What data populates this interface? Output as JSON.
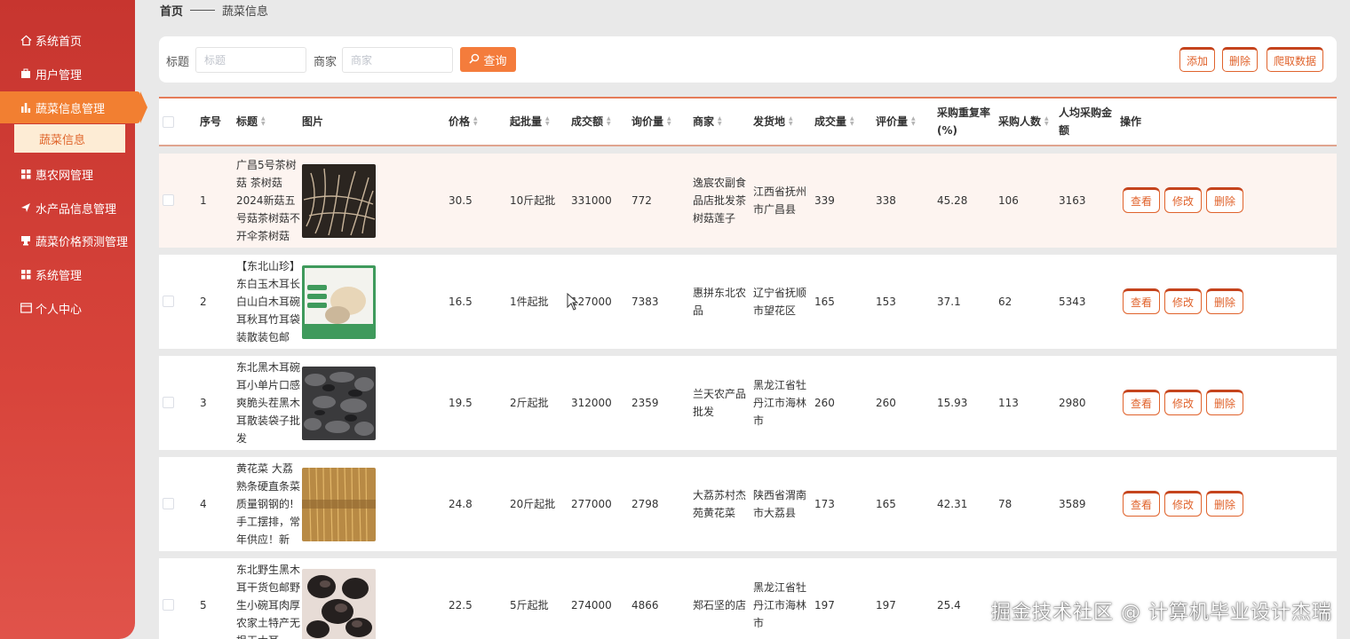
{
  "sidebar": {
    "items": [
      {
        "label": "系统首页",
        "icon": "home-icon"
      },
      {
        "label": "用户管理",
        "icon": "user-icon"
      },
      {
        "label": "蔬菜信息管理",
        "icon": "bar-chart-icon",
        "active": true
      },
      {
        "label": "惠农网管理",
        "icon": "grid-icon"
      },
      {
        "label": "水产品信息管理",
        "icon": "send-icon"
      },
      {
        "label": "蔬菜价格预测管理",
        "icon": "cup-icon"
      },
      {
        "label": "系统管理",
        "icon": "grid-icon"
      },
      {
        "label": "个人中心",
        "icon": "card-icon"
      }
    ],
    "submenu": {
      "label": "蔬菜信息"
    }
  },
  "breadcrumb": {
    "home": "首页",
    "current": "蔬菜信息"
  },
  "search": {
    "title_label": "标题",
    "title_placeholder": "标题",
    "merchant_label": "商家",
    "merchant_placeholder": "商家",
    "query_label": "查询"
  },
  "toolbar": {
    "add": "添加",
    "delete": "删除",
    "crawl": "爬取数据"
  },
  "table": {
    "headers": {
      "index": "序号",
      "title": "标题",
      "image": "图片",
      "price": "价格",
      "min_batch": "起批量",
      "turnover": "成交额",
      "inquiry": "询价量",
      "merchant": "商家",
      "origin": "发货地",
      "deals": "成交量",
      "reviews": "评价量",
      "repurchase": "采购重复率(%)",
      "buyers": "采购人数",
      "avg_amount": "人均采购金额",
      "actions": "操作"
    },
    "action_labels": {
      "view": "查看",
      "edit": "修改",
      "delete": "删除"
    },
    "rows": [
      {
        "index": "1",
        "title": "广昌5号茶树菇 茶树菇2024新菇五号菇茶树菇不开伞茶树菇",
        "price": "30.5",
        "min_batch": "10斤起批",
        "turnover": "331000",
        "inquiry": "772",
        "merchant": "逸宸农副食品店批发茶树菇莲子",
        "origin": "江西省抚州市广昌县",
        "deals": "339",
        "reviews": "338",
        "repurchase": "45.28",
        "buyers": "106",
        "avg_amount": "3163"
      },
      {
        "index": "2",
        "title": "【东北山珍】东白玉木耳长白山白木耳碗耳秋耳竹耳袋装散装包邮",
        "price": "16.5",
        "min_batch": "1件起批",
        "turnover": "127000",
        "inquiry": "7383",
        "merchant": "惠拼东北农品",
        "origin": "辽宁省抚顺市望花区",
        "deals": "165",
        "reviews": "153",
        "repurchase": "37.1",
        "buyers": "62",
        "avg_amount": "5343"
      },
      {
        "index": "3",
        "title": "东北黑木耳碗耳小单片口感爽脆头茬黑木耳散装袋子批发",
        "price": "19.5",
        "min_batch": "2斤起批",
        "turnover": "312000",
        "inquiry": "2359",
        "merchant": "兰天农产品批发",
        "origin": "黑龙江省牡丹江市海林市",
        "deals": "260",
        "reviews": "260",
        "repurchase": "15.93",
        "buyers": "113",
        "avg_amount": "2980"
      },
      {
        "index": "4",
        "title": "黄花菜 大荔熟条硬直条菜质量钢钢的!手工摆排，常年供应！新",
        "price": "24.8",
        "min_batch": "20斤起批",
        "turnover": "277000",
        "inquiry": "2798",
        "merchant": "大荔苏村杰苑黄花菜",
        "origin": "陕西省渭南市大荔县",
        "deals": "173",
        "reviews": "165",
        "repurchase": "42.31",
        "buyers": "78",
        "avg_amount": "3589"
      },
      {
        "index": "5",
        "title": "东北野生黑木耳干货包邮野生小碗耳肉厚农家土特产无根干木耳",
        "price": "22.5",
        "min_batch": "5斤起批",
        "turnover": "274000",
        "inquiry": "4866",
        "merchant": "郑石坚的店",
        "origin": "黑龙江省牡丹江市海林市",
        "deals": "197",
        "reviews": "197",
        "repurchase": "25.4",
        "buyers": "",
        "avg_amount": ""
      }
    ]
  },
  "watermark": "掘金技术社区 @ 计算机毕业设计杰瑞",
  "colors": {
    "sidebar": "#d03c35",
    "accent": "#f27f31",
    "button_border": "#e0632c"
  }
}
